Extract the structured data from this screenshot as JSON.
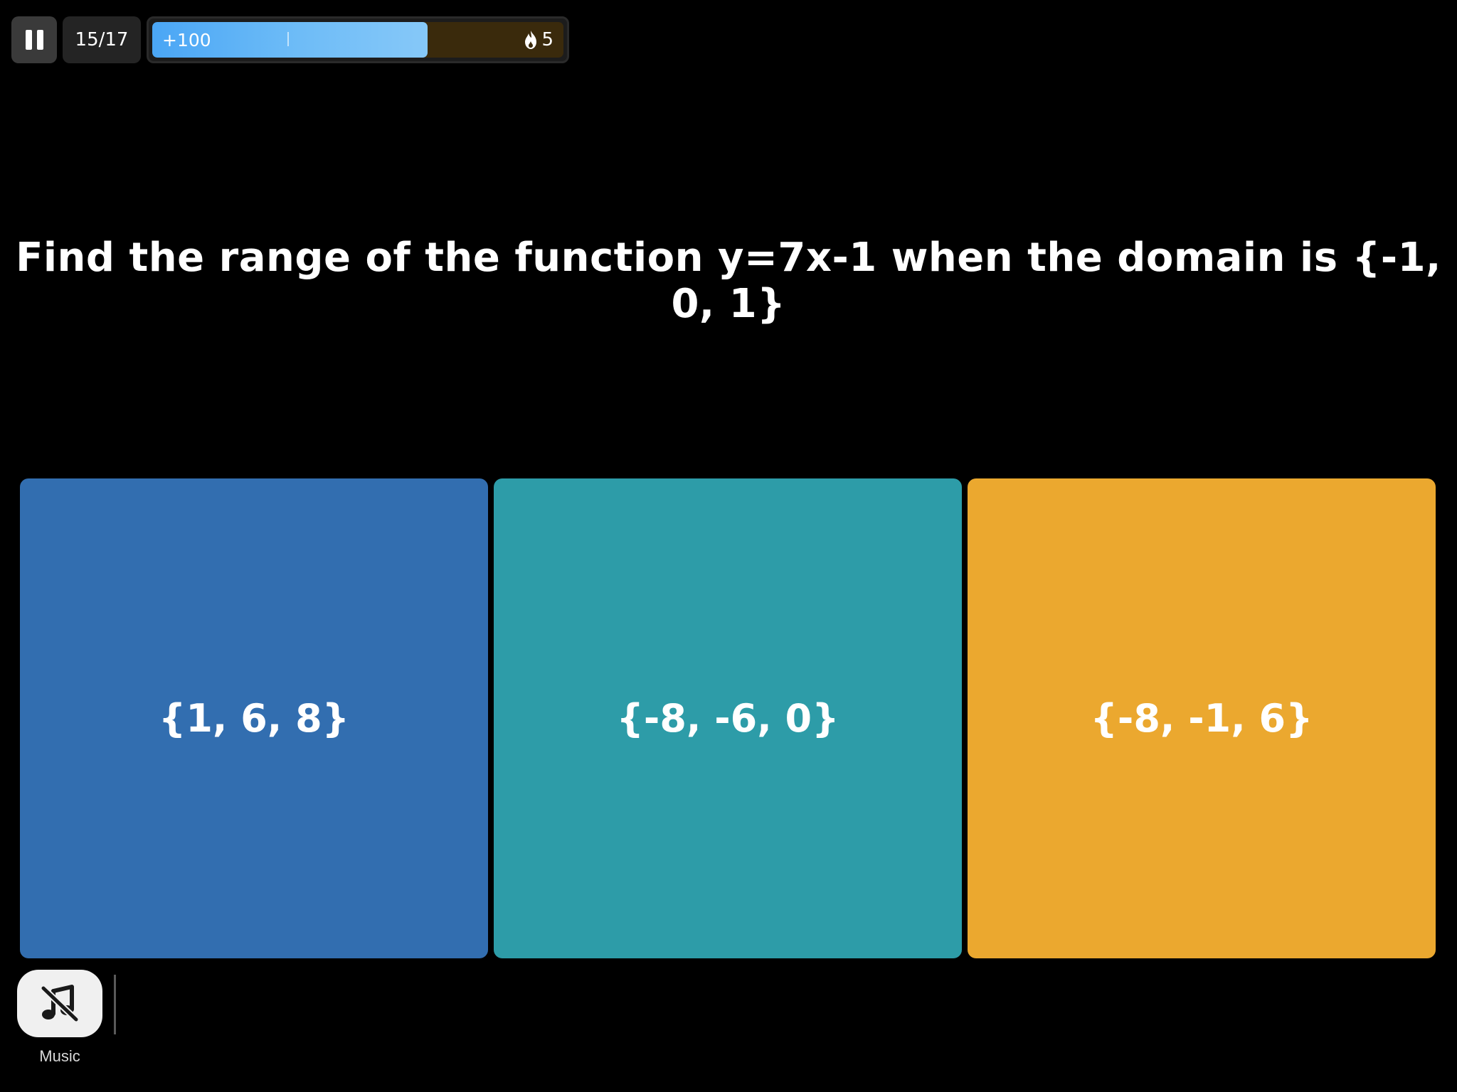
{
  "topbar": {
    "question_counter": "15/17",
    "bonus_label": "+100",
    "progress_fraction": 0.67,
    "streak_count": "5",
    "streak_icon": "flame-icon",
    "pause_icon": "pause-icon"
  },
  "question": {
    "text": "Find the range of the function y=7x-1 when the domain is {-1, 0, 1}"
  },
  "options": [
    {
      "label": "{1, 6, 8}",
      "color": "#326eb0"
    },
    {
      "label": "{-8, -6, 0}",
      "color": "#2d9ca8"
    },
    {
      "label": "{-8, -1, 6}",
      "color": "#eba82f"
    }
  ],
  "music": {
    "label": "Music",
    "icon": "music-off-icon"
  },
  "colors": {
    "background": "#000000",
    "progress_fill": "#6cbbf7",
    "progress_track": "#3a2a0c"
  }
}
